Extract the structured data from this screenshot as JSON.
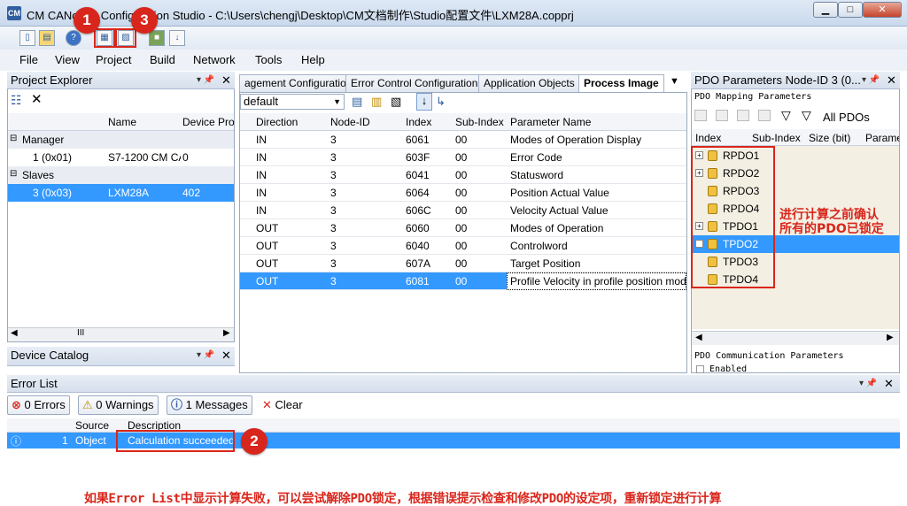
{
  "window": {
    "app_icon": "CM",
    "title": "CM CANopen Configuration Studio - C:\\Users\\chengj\\Desktop\\CM文档制作\\Studio配置文件\\LXM28A.copprj",
    "controls": [
      "minimize",
      "maximize",
      "close"
    ]
  },
  "menu": [
    "File",
    "View",
    "Project",
    "Build",
    "Network",
    "Tools",
    "Help"
  ],
  "toolbar_icons": [
    "new-icon",
    "open-icon",
    "help-icon",
    "build-icon",
    "calculate-icon",
    "network-icon",
    "download-icon"
  ],
  "project_explorer": {
    "title": "Project Explorer",
    "columns": [
      "Name",
      "Device Pro"
    ],
    "groups": [
      {
        "label": "Manager",
        "rows": [
          {
            "id": "1 (0x01)",
            "name": "S7-1200 CM CA",
            "profile": "0"
          }
        ]
      },
      {
        "label": "Slaves",
        "rows": [
          {
            "id": "3 (0x03)",
            "name": "LXM28A",
            "profile": "402"
          }
        ]
      }
    ],
    "scroll_label": "III"
  },
  "device_catalog": {
    "title": "Device Catalog"
  },
  "center": {
    "tabs": [
      "agement Configuration",
      "Error Control Configuration",
      "Application Objects",
      "Process Image"
    ],
    "active_tab": "Process Image",
    "profile_select": "default",
    "columns": [
      "Direction",
      "Node-ID",
      "Index",
      "Sub-Index",
      "Parameter Name"
    ],
    "rows": [
      [
        "IN",
        "3",
        "6061",
        "00",
        "Modes of Operation Display"
      ],
      [
        "IN",
        "3",
        "603F",
        "00",
        "Error Code"
      ],
      [
        "IN",
        "3",
        "6041",
        "00",
        "Statusword"
      ],
      [
        "IN",
        "3",
        "6064",
        "00",
        "Position Actual Value"
      ],
      [
        "IN",
        "3",
        "606C",
        "00",
        "Velocity Actual Value"
      ],
      [
        "OUT",
        "3",
        "6060",
        "00",
        "Modes of Operation"
      ],
      [
        "OUT",
        "3",
        "6040",
        "00",
        "Controlword"
      ],
      [
        "OUT",
        "3",
        "607A",
        "00",
        "Target Position"
      ],
      [
        "OUT",
        "3",
        "6081",
        "00",
        "Profile Velocity in profile position mode"
      ]
    ],
    "selected_row": 8
  },
  "pdo": {
    "title": "PDO Parameters Node-ID 3 (0...",
    "mapping_label": "PDO Mapping Parameters",
    "filter_label": "All PDOs",
    "columns": [
      "Index",
      "Sub-Index",
      "Size (bit)",
      "Parame"
    ],
    "items": [
      {
        "label": "RPDO1",
        "expandable": true
      },
      {
        "label": "RPDO2",
        "expandable": true
      },
      {
        "label": "RPDO3",
        "expandable": false
      },
      {
        "label": "RPDO4",
        "expandable": false
      },
      {
        "label": "TPDO1",
        "expandable": true
      },
      {
        "label": "TPDO2",
        "expandable": true
      },
      {
        "label": "TPDO3",
        "expandable": false
      },
      {
        "label": "TPDO4",
        "expandable": false
      }
    ],
    "selected_item": 5,
    "annotation": [
      "进行计算之前确认",
      "所有的PDO已锁定"
    ],
    "comm_label": "PDO Communication Parameters",
    "comm_partial": "Enabled"
  },
  "error_list": {
    "title": "Error List",
    "errors_btn": "0 Errors",
    "warnings_btn": "0 Warnings",
    "messages_btn": "1 Messages",
    "clear_btn": "Clear",
    "columns": [
      "Source",
      "Description"
    ],
    "rows": [
      {
        "num": "1",
        "source": "Object",
        "description": "Calculation succeeded"
      }
    ]
  },
  "markers": [
    "1",
    "3",
    "2"
  ],
  "footer_note": "如果Error List中显示计算失败，可以尝试解除PDO锁定，根据错误提示检查和修改PDO的设定项，重新锁定进行计算",
  "colors": {
    "selection": "#3399ff",
    "annotation_red": "#d9261c",
    "panel_bg": "#f3efe2"
  }
}
